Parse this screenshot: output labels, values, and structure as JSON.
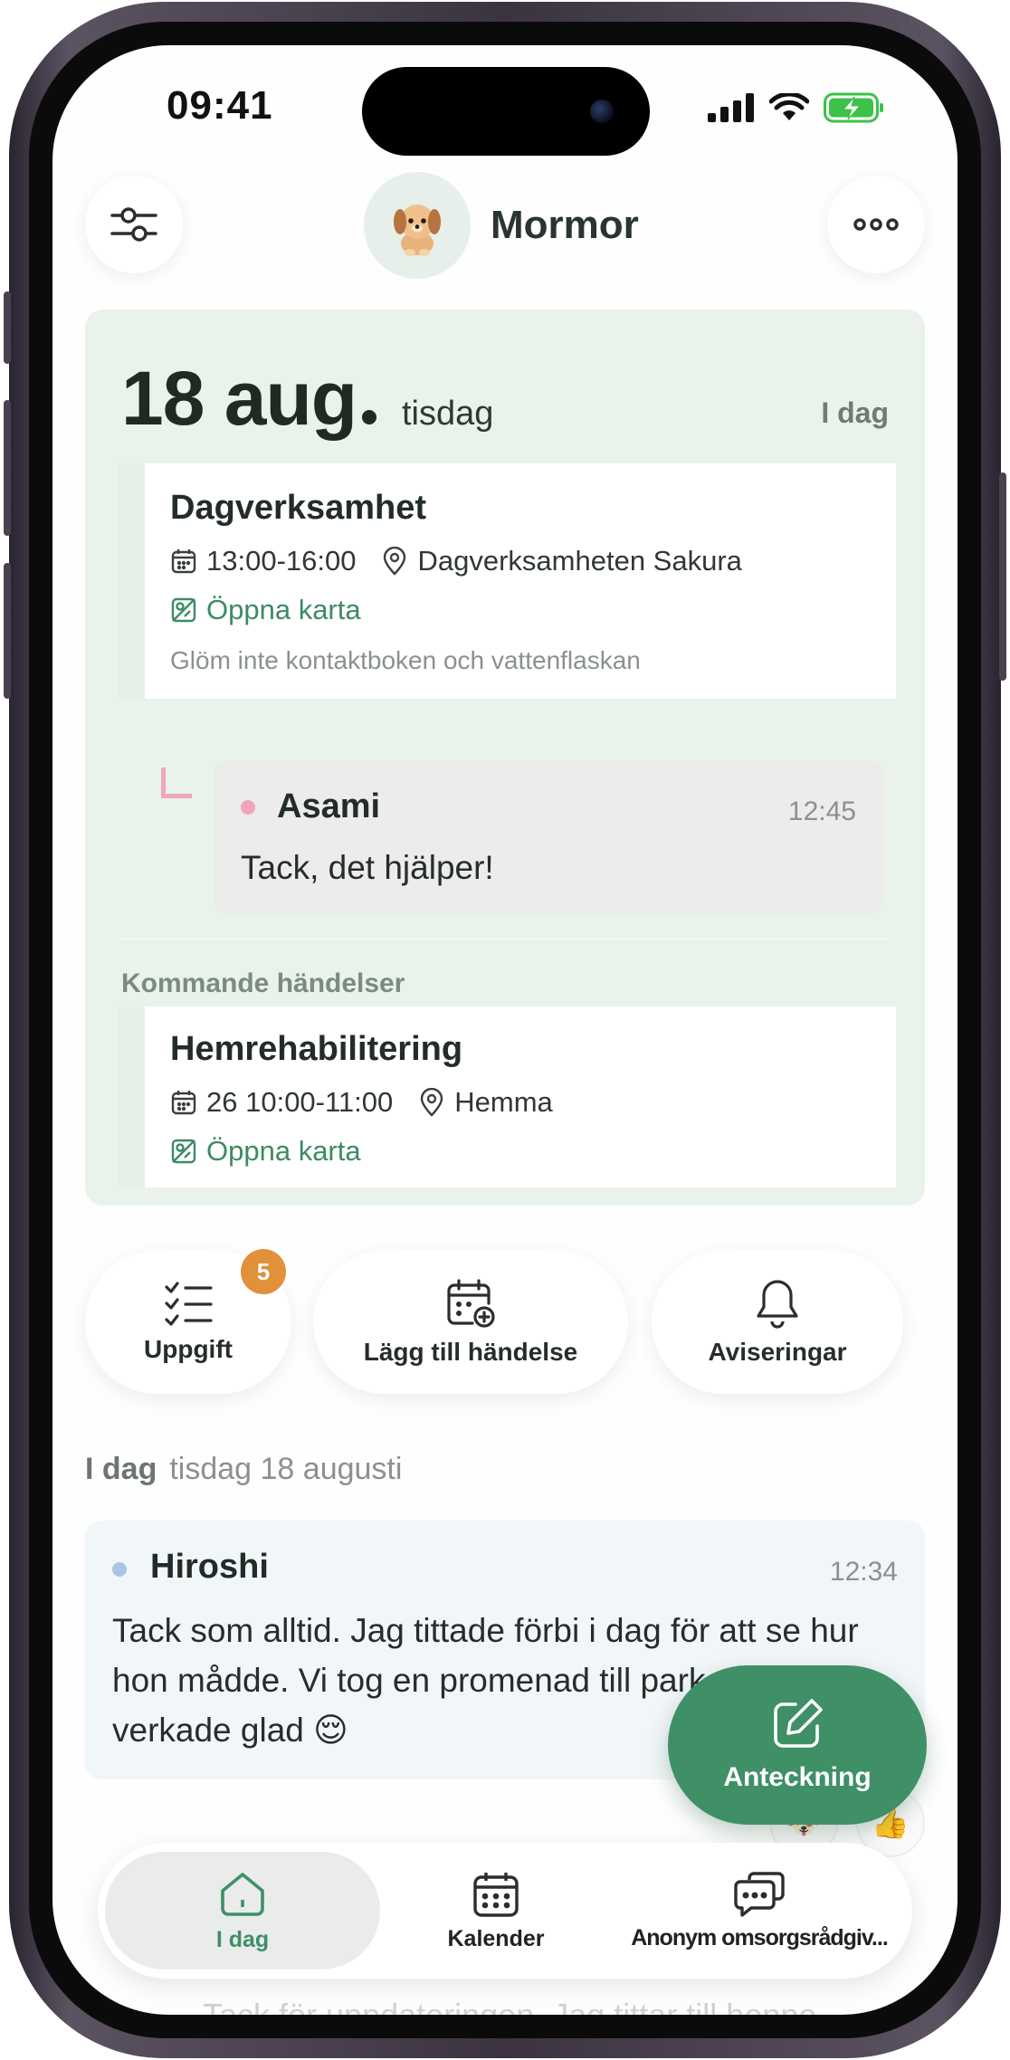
{
  "status_bar": {
    "time": "09:41"
  },
  "header": {
    "profile_name": "Mormor",
    "filter_icon": "sliders-icon",
    "more_icon": "more-horizontal-icon",
    "avatar_icon": "dog-avatar-icon"
  },
  "today_section": {
    "date": "18 aug",
    "weekday": "tisdag",
    "tag": "I dag",
    "event": {
      "title": "Dagverksamhet",
      "time": "13:00-16:00",
      "location": "Dagverksamheten Sakura",
      "map_link": "Öppna karta",
      "note": "Glöm inte kontaktboken och vattenflaskan"
    },
    "reply": {
      "author": "Asami",
      "time": "12:45",
      "text": "Tack, det hjälper!",
      "dot_color": "#f0a6b8"
    },
    "upcoming_heading": "Kommande händelser",
    "upcoming_event": {
      "title": "Hemrehabilitering",
      "time": "26 10:00-11:00",
      "location": "Hemma",
      "map_link": "Öppna karta"
    }
  },
  "quick_actions": [
    {
      "label": "Uppgift",
      "icon": "checklist-icon",
      "badge": "5"
    },
    {
      "label": "Lägg till händelse",
      "icon": "calendar-add-icon"
    },
    {
      "label": "Aviseringar",
      "icon": "bell-icon"
    }
  ],
  "feed": {
    "day_label": "I dag",
    "date_label": "tisdag 18 augusti",
    "post": {
      "author": "Hiroshi",
      "time": "12:34",
      "text": "Tack som alltid. Jag tittade förbi i dag för att se hur hon mådde. Vi tog en promenad till parken och hon verkade glad 😌",
      "dot_color": "#a9c4e4"
    },
    "next_preview": "Tack för uppdateringen. Jag tittar till henne"
  },
  "fab": {
    "label": "Anteckning",
    "icon": "edit-icon"
  },
  "tabbar": [
    {
      "label": "I dag",
      "icon": "home-icon",
      "active": true
    },
    {
      "label": "Kalender",
      "icon": "calendar-icon"
    },
    {
      "label": "Anonym omsorgsrådgiv...",
      "icon": "chat-bubbles-icon"
    }
  ],
  "colors": {
    "accent": "#3f8f67",
    "today_bg": "#e9f3ec",
    "badge": "#e0913a",
    "feed_bg": "#f1f6f8"
  }
}
